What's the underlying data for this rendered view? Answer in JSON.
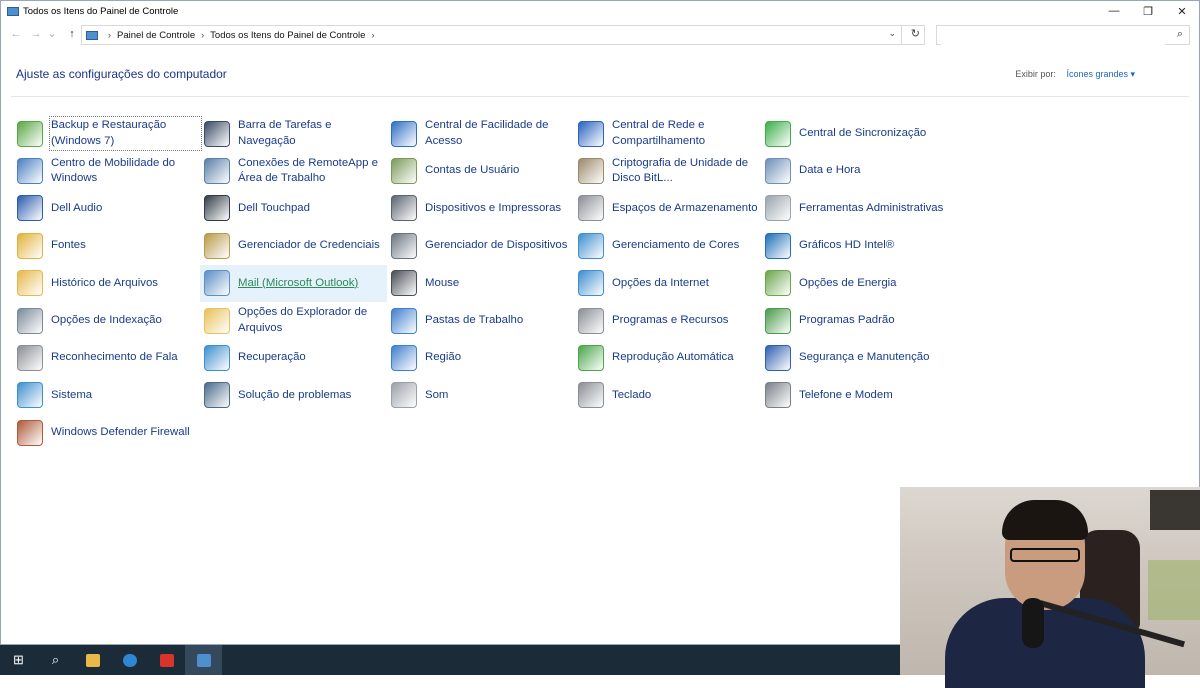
{
  "window": {
    "title": "Todos os Itens do Painel de Controle",
    "controls": {
      "minimize": "—",
      "restore": "❐",
      "close": "✕"
    }
  },
  "nav": {
    "back": "←",
    "forward": "→",
    "recent": "⌄",
    "up": "↑"
  },
  "address": {
    "breadcrumbs": [
      "Painel de Controle",
      "Todos os Itens do Painel de Controle"
    ],
    "separator": "›",
    "dropdown": "⌄",
    "refresh": "↻"
  },
  "search": {
    "placeholder": "",
    "icon": "⌕"
  },
  "header": {
    "title": "Ajuste as configurações do computador",
    "view_by_label": "Exibir por:",
    "view_by_value": "Ícones grandes ▾"
  },
  "items": [
    {
      "label": "Backup e Restauração (Windows 7)",
      "icon": "backup-icon",
      "color": "#5aa845"
    },
    {
      "label": "Barra de Tarefas e Navegação",
      "icon": "taskbar-icon",
      "color": "#3b4c66"
    },
    {
      "label": "Central de Facilidade de Acesso",
      "icon": "ease-of-access-icon",
      "color": "#2f6fc4"
    },
    {
      "label": "Central de Rede e Compartilhamento",
      "icon": "network-icon",
      "color": "#2b63c0"
    },
    {
      "label": "Central de Sincronização",
      "icon": "sync-icon",
      "color": "#3cae4a"
    },
    {
      "label": "Centro de Mobilidade do Windows",
      "icon": "mobility-icon",
      "color": "#4a7fc1"
    },
    {
      "label": "Conexões de RemoteApp e Área de Trabalho",
      "icon": "remoteapp-icon",
      "color": "#5a7fa8"
    },
    {
      "label": "Contas de Usuário",
      "icon": "user-accounts-icon",
      "color": "#7a9a5a"
    },
    {
      "label": "Criptografia de Unidade de Disco BitL...",
      "icon": "bitlocker-icon",
      "color": "#9a8a6a"
    },
    {
      "label": "Data e Hora",
      "icon": "date-time-icon",
      "color": "#6f8fb8"
    },
    {
      "label": "Dell Audio",
      "icon": "dell-audio-icon",
      "color": "#2c5bb0"
    },
    {
      "label": "Dell Touchpad",
      "icon": "touchpad-icon",
      "color": "#333c46"
    },
    {
      "label": "Dispositivos e Impressoras",
      "icon": "printer-icon",
      "color": "#5b6470"
    },
    {
      "label": "Espaços de Armazenamento",
      "icon": "storage-spaces-icon",
      "color": "#8a8f96"
    },
    {
      "label": "Ferramentas Administrativas",
      "icon": "admin-tools-icon",
      "color": "#9aa3ad"
    },
    {
      "label": "Fontes",
      "icon": "fonts-icon",
      "color": "#e2b33a"
    },
    {
      "label": "Gerenciador de Credenciais",
      "icon": "credential-manager-icon",
      "color": "#b89a4a"
    },
    {
      "label": "Gerenciador de Dispositivos",
      "icon": "device-manager-icon",
      "color": "#6a7480"
    },
    {
      "label": "Gerenciamento de Cores",
      "icon": "color-management-icon",
      "color": "#3f8fcf"
    },
    {
      "label": "Gráficos HD Intel®",
      "icon": "intel-graphics-icon",
      "color": "#1f6fb8"
    },
    {
      "label": "Histórico de Arquivos",
      "icon": "file-history-icon",
      "color": "#e6b84a"
    },
    {
      "label": "Mail (Microsoft Outlook)",
      "icon": "mail-icon",
      "color": "#5d8fc4"
    },
    {
      "label": "Mouse",
      "icon": "mouse-icon",
      "color": "#4a4f56"
    },
    {
      "label": "Opções da Internet",
      "icon": "internet-options-icon",
      "color": "#3f8fcf"
    },
    {
      "label": "Opções de Energia",
      "icon": "power-options-icon",
      "color": "#6aa64a"
    },
    {
      "label": "Opções de Indexação",
      "icon": "indexing-icon",
      "color": "#7a8a9a"
    },
    {
      "label": "Opções do Explorador de Arquivos",
      "icon": "folder-options-icon",
      "color": "#e9c15a"
    },
    {
      "label": "Pastas de Trabalho",
      "icon": "work-folders-icon",
      "color": "#3f7fcf"
    },
    {
      "label": "Programas e Recursos",
      "icon": "programs-icon",
      "color": "#8a8f96"
    },
    {
      "label": "Programas Padrão",
      "icon": "default-programs-icon",
      "color": "#4a9a4a"
    },
    {
      "label": "Reconhecimento de Fala",
      "icon": "microphone-icon",
      "color": "#8a8f96"
    },
    {
      "label": "Recuperação",
      "icon": "recovery-icon",
      "color": "#3f8fcf"
    },
    {
      "label": "Região",
      "icon": "region-icon",
      "color": "#3f7fcf"
    },
    {
      "label": "Reprodução Automática",
      "icon": "autoplay-icon",
      "color": "#4aa64a"
    },
    {
      "label": "Segurança e Manutenção",
      "icon": "security-flag-icon",
      "color": "#2f5fb0"
    },
    {
      "label": "Sistema",
      "icon": "system-icon",
      "color": "#3f8fcf"
    },
    {
      "label": "Solução de problemas",
      "icon": "troubleshoot-icon",
      "color": "#4a6a8a"
    },
    {
      "label": "Som",
      "icon": "sound-icon",
      "color": "#9aa0a8"
    },
    {
      "label": "Teclado",
      "icon": "keyboard-icon",
      "color": "#8a8f96"
    },
    {
      "label": "Telefone e Modem",
      "icon": "phone-modem-icon",
      "color": "#7a8088"
    },
    {
      "label": "Windows Defender Firewall",
      "icon": "firewall-icon",
      "color": "#b05a3a"
    }
  ],
  "taskbar": [
    {
      "icon": "windows-start-icon",
      "glyph": "⊞"
    },
    {
      "icon": "search-icon",
      "glyph": "⌕"
    },
    {
      "icon": "file-explorer-icon",
      "glyph": ""
    },
    {
      "icon": "edge-icon",
      "glyph": ""
    },
    {
      "icon": "anydesk-icon",
      "glyph": ""
    },
    {
      "icon": "control-panel-icon",
      "glyph": ""
    }
  ],
  "colors": {
    "link": "#1a3b8a",
    "heading": "#1e3287",
    "hover_bg": "#e5f1fb",
    "taskbar": "#1c2b38"
  }
}
